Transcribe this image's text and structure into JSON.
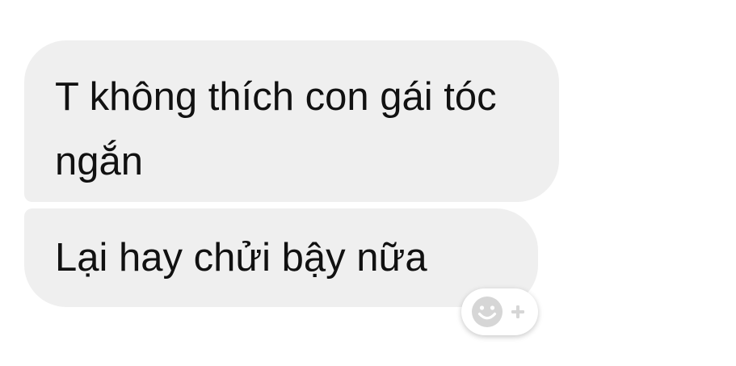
{
  "messages": [
    {
      "text": "T không thích con gái tóc ngắn"
    },
    {
      "text": "Lại hay chửi bậy nữa"
    }
  ],
  "reaction_button": {
    "icon": "smiley-add-icon"
  },
  "colors": {
    "bubble_background": "#efefef",
    "text": "#111111",
    "icon": "#d6d6d6",
    "page_background": "#ffffff"
  }
}
